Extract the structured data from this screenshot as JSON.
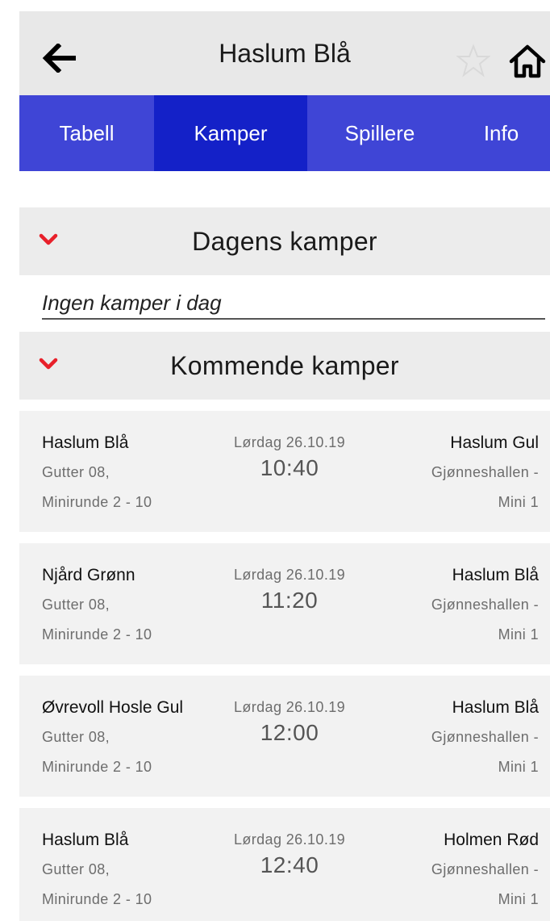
{
  "header": {
    "title": "Haslum Blå",
    "back_icon": "arrow-left-icon",
    "favorite_icon": "star-outline-icon",
    "home_icon": "home-icon"
  },
  "tabs": [
    {
      "label": "Tabell",
      "active": false
    },
    {
      "label": "Kamper",
      "active": true
    },
    {
      "label": "Spillere",
      "active": false
    },
    {
      "label": "Info",
      "active": false
    }
  ],
  "colors": {
    "tab_bar": "#3f45d6",
    "tab_active": "#1421c8",
    "chevron": "#e8202a",
    "header_bg": "#e8e8e8",
    "card_bg": "#f2f2f2"
  },
  "today": {
    "title": "Dagens kamper",
    "empty_text": "Ingen kamper i dag"
  },
  "upcoming": {
    "title": "Kommende kamper",
    "matches": [
      {
        "home": "Haslum Blå",
        "league_line1": "Gutter 08,",
        "league_line2": "Minirunde 2 - 10",
        "date": "Lørdag 26.10.19",
        "time": "10:40",
        "away": "Haslum Gul",
        "venue_line1": "Gjønneshallen -",
        "venue_line2": "Mini 1"
      },
      {
        "home": "Njård Grønn",
        "league_line1": "Gutter 08,",
        "league_line2": "Minirunde 2 - 10",
        "date": "Lørdag 26.10.19",
        "time": "11:20",
        "away": "Haslum Blå",
        "venue_line1": "Gjønneshallen -",
        "venue_line2": "Mini 1"
      },
      {
        "home": "Øvrevoll Hosle Gul",
        "league_line1": "Gutter 08,",
        "league_line2": "Minirunde 2 - 10",
        "date": "Lørdag 26.10.19",
        "time": "12:00",
        "away": "Haslum Blå",
        "venue_line1": "Gjønneshallen -",
        "venue_line2": "Mini 1"
      },
      {
        "home": "Haslum Blå",
        "league_line1": "Gutter 08,",
        "league_line2": "Minirunde 2 - 10",
        "date": "Lørdag 26.10.19",
        "time": "12:40",
        "away": "Holmen Rød",
        "venue_line1": "Gjønneshallen -",
        "venue_line2": "Mini 1"
      }
    ]
  }
}
